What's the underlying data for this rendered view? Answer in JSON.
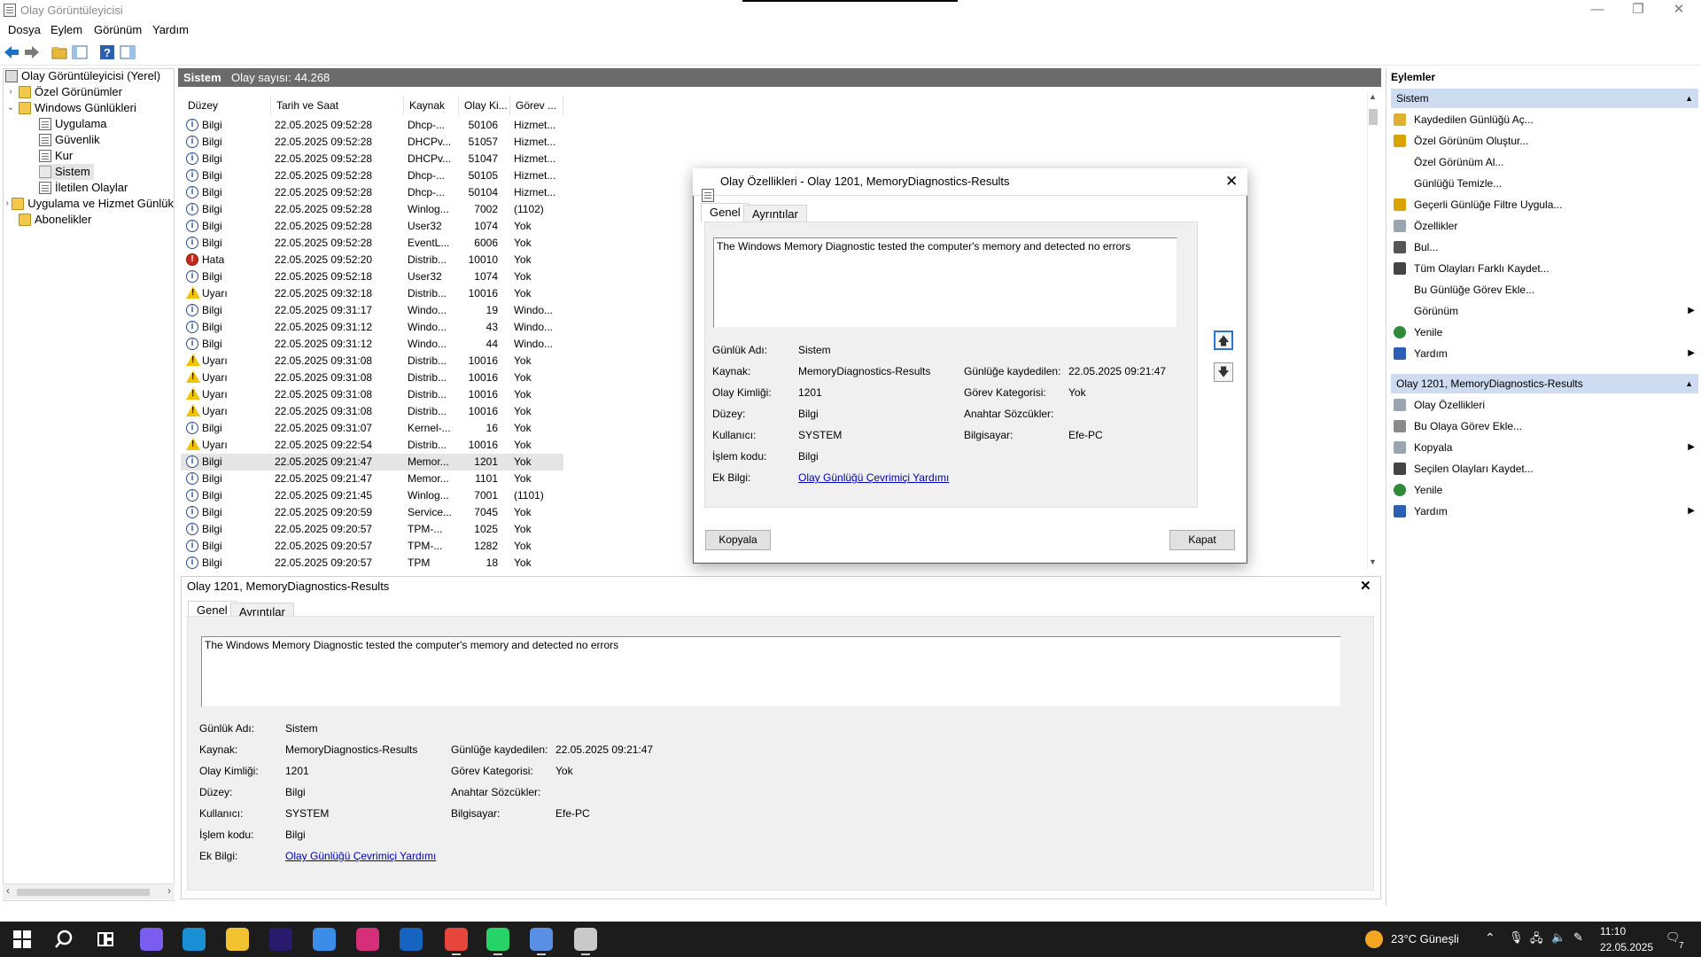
{
  "window": {
    "title": "Olay Görüntüleyicisi",
    "min": "—",
    "restore": "❐",
    "close": "✕"
  },
  "menu": [
    "Dosya",
    "Eylem",
    "Görünüm",
    "Yardım"
  ],
  "tree": {
    "root": "Olay Görüntüleyicisi (Yerel)",
    "custom_views": "Özel Görünümler",
    "windows_logs": "Windows Günlükleri",
    "logs": [
      "Uygulama",
      "Güvenlik",
      "Kur",
      "Sistem",
      "İletilen Olaylar"
    ],
    "app_service": "Uygulama ve Hizmet Günlük",
    "subscriptions": "Abonelikler"
  },
  "center": {
    "title": "Sistem",
    "count_label": "Olay sayısı: 44.268"
  },
  "grid": {
    "columns": [
      "Düzey",
      "Tarih ve Saat",
      "Kaynak",
      "Olay Ki...",
      "Görev ..."
    ],
    "rows": [
      {
        "level": "Bilgi",
        "type": "info",
        "date": "22.05.2025 09:52:28",
        "source": "Dhcp-...",
        "id": "50106",
        "task": "Hizmet..."
      },
      {
        "level": "Bilgi",
        "type": "info",
        "date": "22.05.2025 09:52:28",
        "source": "DHCPv...",
        "id": "51057",
        "task": "Hizmet..."
      },
      {
        "level": "Bilgi",
        "type": "info",
        "date": "22.05.2025 09:52:28",
        "source": "DHCPv...",
        "id": "51047",
        "task": "Hizmet..."
      },
      {
        "level": "Bilgi",
        "type": "info",
        "date": "22.05.2025 09:52:28",
        "source": "Dhcp-...",
        "id": "50105",
        "task": "Hizmet..."
      },
      {
        "level": "Bilgi",
        "type": "info",
        "date": "22.05.2025 09:52:28",
        "source": "Dhcp-...",
        "id": "50104",
        "task": "Hizmet..."
      },
      {
        "level": "Bilgi",
        "type": "info",
        "date": "22.05.2025 09:52:28",
        "source": "Winlog...",
        "id": "7002",
        "task": "(1102)"
      },
      {
        "level": "Bilgi",
        "type": "info",
        "date": "22.05.2025 09:52:28",
        "source": "User32",
        "id": "1074",
        "task": "Yok"
      },
      {
        "level": "Bilgi",
        "type": "info",
        "date": "22.05.2025 09:52:28",
        "source": "EventL...",
        "id": "6006",
        "task": "Yok"
      },
      {
        "level": "Hata",
        "type": "error",
        "date": "22.05.2025 09:52:20",
        "source": "Distrib...",
        "id": "10010",
        "task": "Yok"
      },
      {
        "level": "Bilgi",
        "type": "info",
        "date": "22.05.2025 09:52:18",
        "source": "User32",
        "id": "1074",
        "task": "Yok"
      },
      {
        "level": "Uyarı",
        "type": "warn",
        "date": "22.05.2025 09:32:18",
        "source": "Distrib...",
        "id": "10016",
        "task": "Yok"
      },
      {
        "level": "Bilgi",
        "type": "info",
        "date": "22.05.2025 09:31:17",
        "source": "Windo...",
        "id": "19",
        "task": "Windo..."
      },
      {
        "level": "Bilgi",
        "type": "info",
        "date": "22.05.2025 09:31:12",
        "source": "Windo...",
        "id": "43",
        "task": "Windo..."
      },
      {
        "level": "Bilgi",
        "type": "info",
        "date": "22.05.2025 09:31:12",
        "source": "Windo...",
        "id": "44",
        "task": "Windo..."
      },
      {
        "level": "Uyarı",
        "type": "warn",
        "date": "22.05.2025 09:31:08",
        "source": "Distrib...",
        "id": "10016",
        "task": "Yok"
      },
      {
        "level": "Uyarı",
        "type": "warn",
        "date": "22.05.2025 09:31:08",
        "source": "Distrib...",
        "id": "10016",
        "task": "Yok"
      },
      {
        "level": "Uyarı",
        "type": "warn",
        "date": "22.05.2025 09:31:08",
        "source": "Distrib...",
        "id": "10016",
        "task": "Yok"
      },
      {
        "level": "Uyarı",
        "type": "warn",
        "date": "22.05.2025 09:31:08",
        "source": "Distrib...",
        "id": "10016",
        "task": "Yok"
      },
      {
        "level": "Bilgi",
        "type": "info",
        "date": "22.05.2025 09:31:07",
        "source": "Kernel-...",
        "id": "16",
        "task": "Yok"
      },
      {
        "level": "Uyarı",
        "type": "warn",
        "date": "22.05.2025 09:22:54",
        "source": "Distrib...",
        "id": "10016",
        "task": "Yok"
      },
      {
        "level": "Bilgi",
        "type": "info",
        "date": "22.05.2025 09:21:47",
        "source": "Memor...",
        "id": "1201",
        "task": "Yok",
        "selected": true
      },
      {
        "level": "Bilgi",
        "type": "info",
        "date": "22.05.2025 09:21:47",
        "source": "Memor...",
        "id": "1101",
        "task": "Yok"
      },
      {
        "level": "Bilgi",
        "type": "info",
        "date": "22.05.2025 09:21:45",
        "source": "Winlog...",
        "id": "7001",
        "task": "(1101)"
      },
      {
        "level": "Bilgi",
        "type": "info",
        "date": "22.05.2025 09:20:59",
        "source": "Service...",
        "id": "7045",
        "task": "Yok"
      },
      {
        "level": "Bilgi",
        "type": "info",
        "date": "22.05.2025 09:20:57",
        "source": "TPM-...",
        "id": "1025",
        "task": "Yok"
      },
      {
        "level": "Bilgi",
        "type": "info",
        "date": "22.05.2025 09:20:57",
        "source": "TPM-...",
        "id": "1282",
        "task": "Yok"
      },
      {
        "level": "Bilgi",
        "type": "info",
        "date": "22.05.2025 09:20:57",
        "source": "TPM",
        "id": "18",
        "task": "Yok"
      }
    ]
  },
  "detail": {
    "title": "Olay 1201, MemoryDiagnostics-Results",
    "close": "✕",
    "tabs": [
      "Genel",
      "Ayrıntılar"
    ],
    "message": "The Windows Memory Diagnostic tested the computer's memory and detected no errors",
    "labels": {
      "log_name": "Günlük Adı:",
      "source": "Kaynak:",
      "event_id": "Olay Kimliği:",
      "level": "Düzey:",
      "user": "Kullanıcı:",
      "opcode": "İşlem kodu:",
      "more_info": "Ek Bilgi:",
      "logged": "Günlüğe kaydedilen:",
      "task_category": "Görev Kategorisi:",
      "keywords": "Anahtar Sözcükler:",
      "computer": "Bilgisayar:"
    },
    "values": {
      "log_name": "Sistem",
      "source": "MemoryDiagnostics-Results",
      "event_id": "1201",
      "level": "Bilgi",
      "user": "SYSTEM",
      "opcode": "Bilgi",
      "more_info": "Olay Günlüğü Çevrimiçi Yardımı",
      "logged": "22.05.2025 09:21:47",
      "task_category": "Yok",
      "keywords": "",
      "computer": "Efe-PC"
    }
  },
  "dialog": {
    "title": "Olay Özellikleri - Olay 1201, MemoryDiagnostics-Results",
    "close": "✕",
    "copy_button": "Kopyala",
    "close_button": "Kapat",
    "up_arrow": "🡅",
    "down_arrow": "🡇"
  },
  "actions": {
    "header": "Eylemler",
    "section1": "Sistem",
    "items1": [
      {
        "label": "Kaydedilen Günlüğü Aç...",
        "icon": "folder-open-icon",
        "color": "#e0b030"
      },
      {
        "label": "Özel Görünüm Oluştur...",
        "icon": "filter-icon",
        "color": "#d9a400"
      },
      {
        "label": "Özel Görünüm Al...",
        "icon": "",
        "color": ""
      },
      {
        "label": "Günlüğü Temizle...",
        "icon": "",
        "color": ""
      },
      {
        "label": "Geçerli Günlüğe Filtre Uygula...",
        "icon": "filter-icon",
        "color": "#d9a400"
      },
      {
        "label": "Özellikler",
        "icon": "properties-icon",
        "color": "#9aa5b1"
      },
      {
        "label": "Bul...",
        "icon": "find-icon",
        "color": "#555555"
      },
      {
        "label": "Tüm Olayları Farklı Kaydet...",
        "icon": "save-icon",
        "color": "#444444"
      },
      {
        "label": "Bu Günlüğe Görev Ekle...",
        "icon": "",
        "color": ""
      },
      {
        "label": "Görünüm",
        "icon": "",
        "color": "",
        "submenu": true
      },
      {
        "label": "Yenile",
        "icon": "refresh-icon",
        "color": "#2e8b3a"
      },
      {
        "label": "Yardım",
        "icon": "help-icon",
        "color": "#2b5fb4",
        "submenu": true
      }
    ],
    "section2": "Olay 1201, MemoryDiagnostics-Results",
    "items2": [
      {
        "label": "Olay Özellikleri",
        "icon": "properties-icon",
        "color": "#9aa5b1"
      },
      {
        "label": "Bu Olaya Görev Ekle...",
        "icon": "task-icon",
        "color": "#8a8a8a"
      },
      {
        "label": "Kopyala",
        "icon": "copy-icon",
        "color": "#9aa5b1",
        "submenu": true
      },
      {
        "label": "Seçilen Olayları Kaydet...",
        "icon": "save-icon",
        "color": "#444444"
      },
      {
        "label": "Yenile",
        "icon": "refresh-icon",
        "color": "#2e8b3a"
      },
      {
        "label": "Yardım",
        "icon": "help-icon",
        "color": "#2b5fb4",
        "submenu": true
      }
    ]
  },
  "taskbar": {
    "apps": [
      {
        "name": "start-icon",
        "color": "#ffffff"
      },
      {
        "name": "search-icon",
        "color": "#ffffff"
      },
      {
        "name": "task-view-icon",
        "color": "#ffffff"
      },
      {
        "name": "copilot-icon",
        "color": "#7b5cf0"
      },
      {
        "name": "edge-icon",
        "color": "#1a8fd6"
      },
      {
        "name": "file-explorer-icon",
        "color": "#f2c230"
      },
      {
        "name": "premiere-icon",
        "color": "#2a1a6e"
      },
      {
        "name": "store-icon",
        "color": "#3b8ee8"
      },
      {
        "name": "instagram-icon",
        "color": "#d62f7a"
      },
      {
        "name": "outlook-icon",
        "color": "#1565c0"
      },
      {
        "name": "chrome-icon",
        "color": "#e5453a"
      },
      {
        "name": "whatsapp-icon",
        "color": "#25d366"
      },
      {
        "name": "microsoft365-icon",
        "color": "#5a8fe6"
      },
      {
        "name": "event-viewer-icon",
        "color": "#c9c9c9"
      }
    ],
    "weather": "23°C  Güneşli",
    "time": "11:10",
    "date": "22.05.2025",
    "notif_count": "7"
  }
}
